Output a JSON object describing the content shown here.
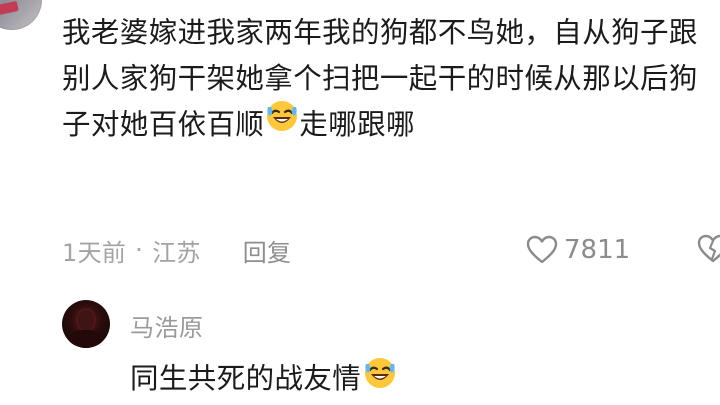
{
  "comment": {
    "line_1": "我老婆嫁进我家两年我的狗都不鸟她，自",
    "line_2": "从狗子跟别人家狗干架她拿个扫把一起干",
    "line_3_part1": "的时候从那以后狗子对她百依百顺",
    "line_3_emoji": "rofl-emoji",
    "line_3_part2": "走哪",
    "line_4": "跟哪",
    "time": "1天前",
    "separator": "·",
    "location": "江苏",
    "reply_label": "回复",
    "like_count": "7811",
    "like_icon": "heart-icon",
    "dislike_icon": "broken-heart-icon"
  },
  "reply": {
    "username": "马浩原",
    "text": "同生共死的战友情",
    "emoji": "rofl-emoji"
  }
}
